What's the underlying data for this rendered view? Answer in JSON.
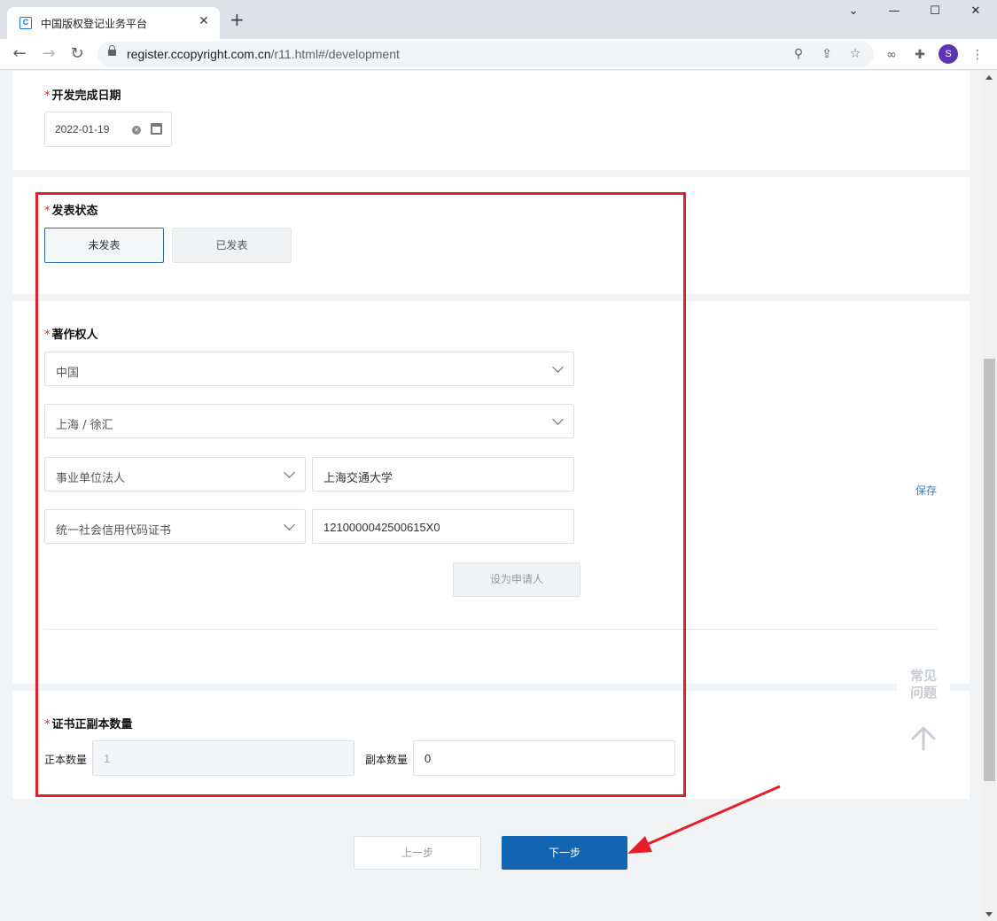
{
  "browser": {
    "tab_title": "中国版权登记业务平台",
    "favicon_letter": "C",
    "url_host": "register.ccopyright.com.cn",
    "url_path": "/r11.html#/development",
    "profile_initial": "S",
    "icons": [
      "back-icon",
      "forward-icon",
      "reload-icon",
      "lock-icon",
      "zoom-icon",
      "share-icon",
      "star-icon",
      "extension-icon",
      "puzzle-icon",
      "menu-icon"
    ]
  },
  "form": {
    "required_mark": "*",
    "completion_date": {
      "label": "开发完成日期",
      "value": "2022-01-19"
    },
    "publish_status": {
      "label": "发表状态",
      "options": [
        "未发表",
        "已发表"
      ],
      "selected": "未发表"
    },
    "copyright_owner": {
      "label": "著作权人",
      "country": "中国",
      "region": "上海 / 徐汇",
      "owner_type": "事业单位法人",
      "owner_name": "上海交通大学",
      "id_type": "统一社会信用代码证书",
      "id_number": "1210000042500615X0",
      "set_applicant_button": "设为申请人",
      "save_link": "保存"
    },
    "certificate_copies": {
      "label": "证书正副本数量",
      "original_label": "正本数量",
      "original_value": "1",
      "duplicate_label": "副本数量",
      "duplicate_value": "0"
    }
  },
  "sidebar_widget": {
    "faq_line1": "常见",
    "faq_line2": "问题"
  },
  "nav": {
    "prev_button": "上一步",
    "next_button": "下一步"
  },
  "colors": {
    "primary": "#1265b3",
    "required": "#e02020",
    "annotation": "#e3202a",
    "link": "#3b7bb5"
  }
}
